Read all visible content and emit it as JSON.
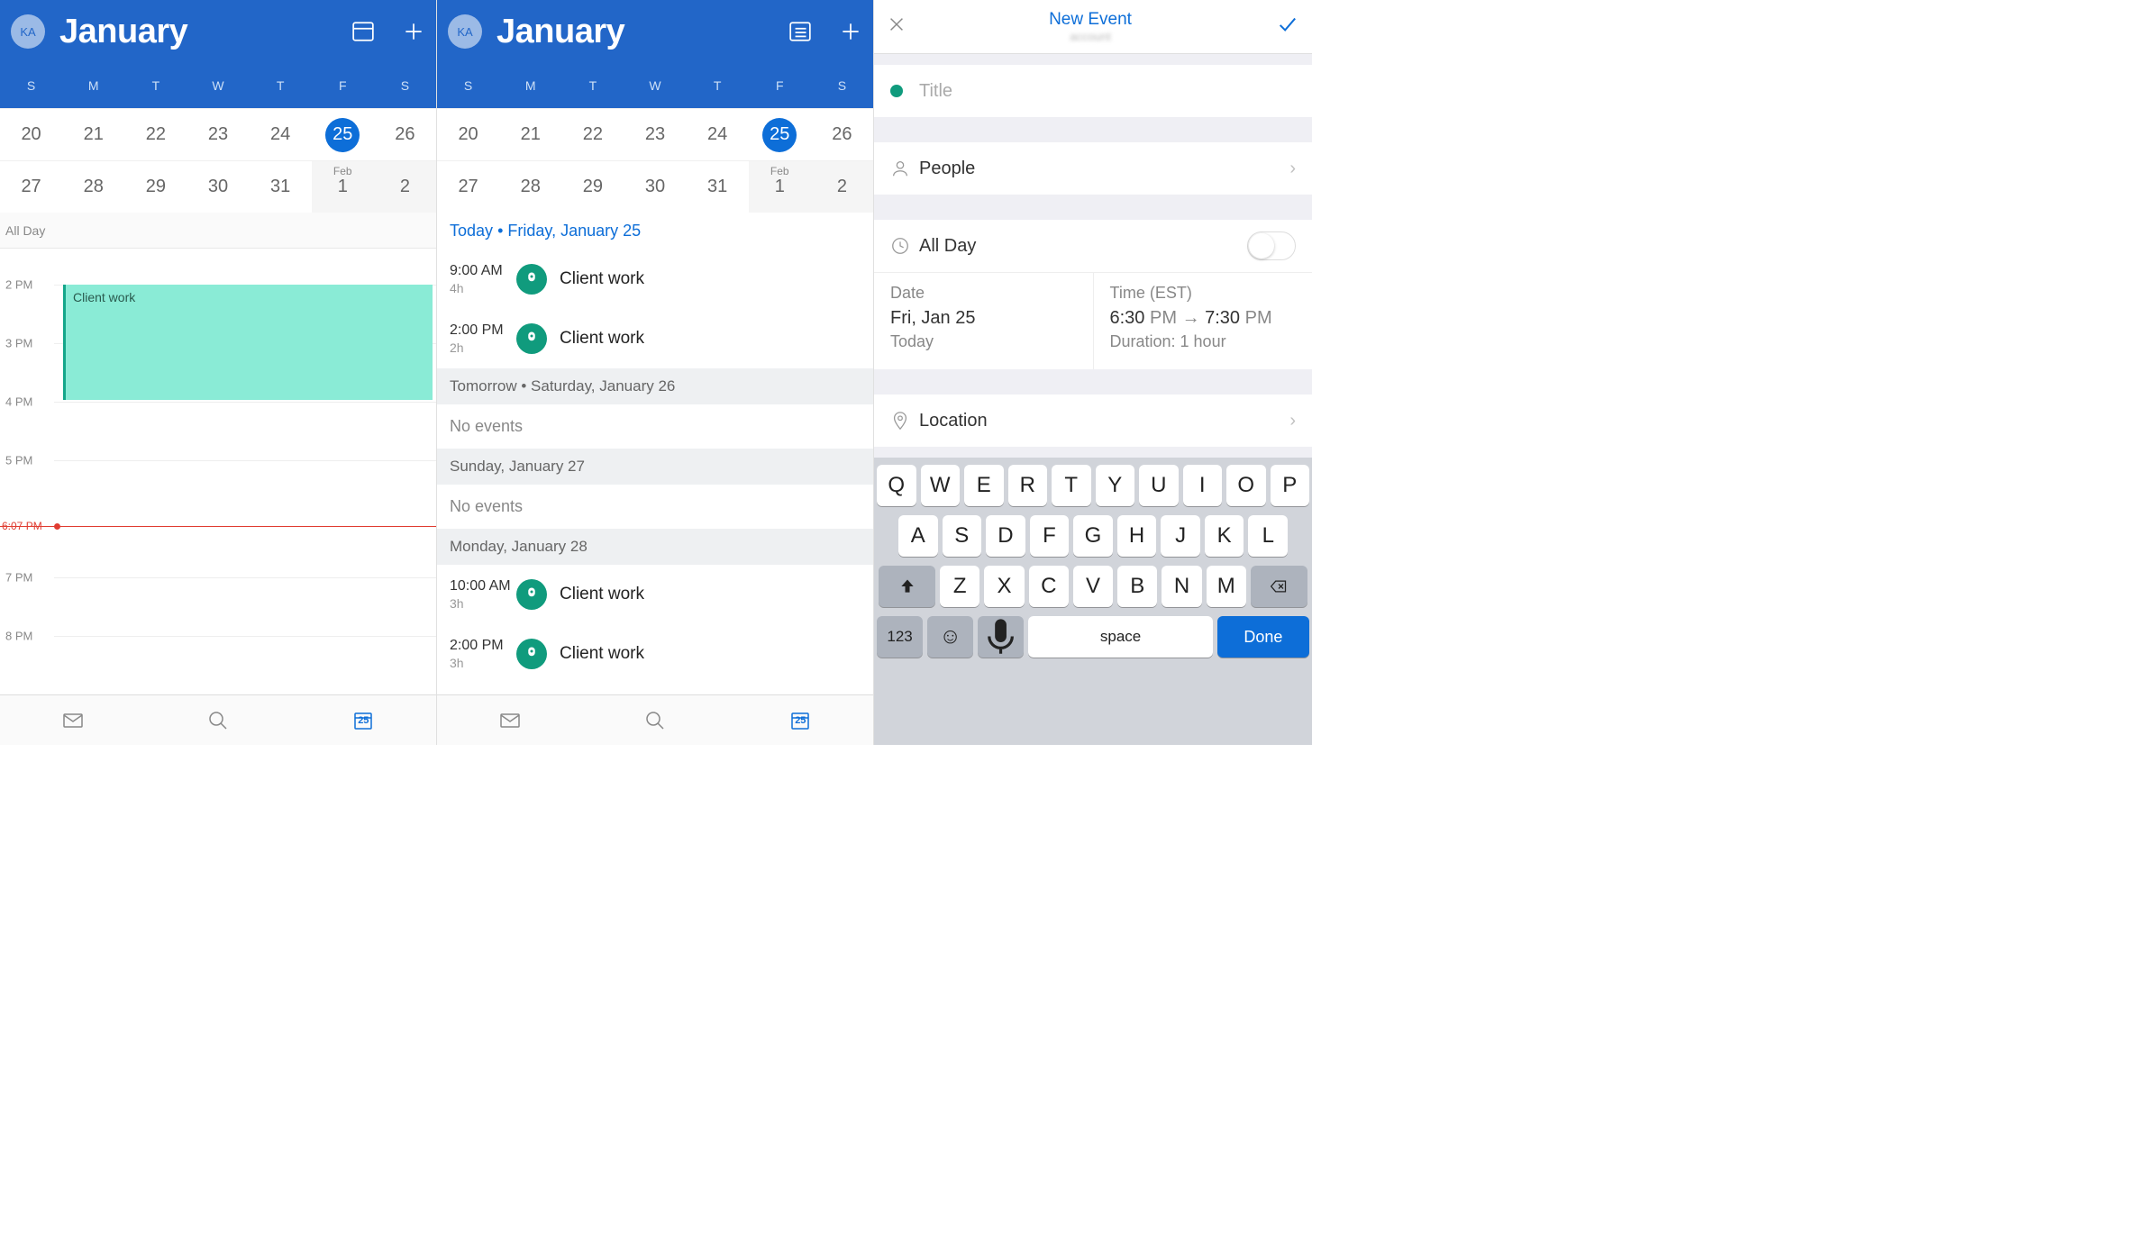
{
  "avatar": "KA",
  "month": "January",
  "weekdays": [
    "S",
    "M",
    "T",
    "W",
    "T",
    "F",
    "S"
  ],
  "row1": [
    "20",
    "21",
    "22",
    "23",
    "24",
    "25",
    "26"
  ],
  "row2": [
    "27",
    "28",
    "29",
    "30",
    "31",
    "1",
    "2"
  ],
  "row2_month": "Feb",
  "allday": "All Day",
  "hours": [
    "2 PM",
    "3 PM",
    "4 PM",
    "5 PM",
    "7 PM",
    "8 PM"
  ],
  "now_time": "6:07 PM",
  "day_event": "Client work",
  "tab_date": "25",
  "agenda": {
    "today_hdr_prefix": "Today",
    "today_hdr_date": "Friday, January 25",
    "events_today": [
      {
        "time": "9:00 AM",
        "dur": "4h",
        "title": "Client work"
      },
      {
        "time": "2:00 PM",
        "dur": "2h",
        "title": "Client work"
      }
    ],
    "tomorrow_hdr": "Tomorrow • Saturday, January 26",
    "no_events": "No events",
    "sunday_hdr": "Sunday, January 27",
    "monday_hdr": "Monday, January 28",
    "events_monday": [
      {
        "time": "10:00 AM",
        "dur": "3h",
        "title": "Client work"
      },
      {
        "time": "2:00 PM",
        "dur": "3h",
        "title": "Client work"
      }
    ]
  },
  "new_event": {
    "title": "New Event",
    "title_placeholder": "Title",
    "people": "People",
    "allday": "All Day",
    "date_label": "Date",
    "date_value": "Fri, Jan 25",
    "date_sub": "Today",
    "time_label": "Time (EST)",
    "time_start": "6:30",
    "time_end": "7:30",
    "pm": "PM",
    "duration": "Duration: 1 hour",
    "location": "Location"
  },
  "kbd": {
    "r1": [
      "Q",
      "W",
      "E",
      "R",
      "T",
      "Y",
      "U",
      "I",
      "O",
      "P"
    ],
    "r2": [
      "A",
      "S",
      "D",
      "F",
      "G",
      "H",
      "J",
      "K",
      "L"
    ],
    "r3": [
      "Z",
      "X",
      "C",
      "V",
      "B",
      "N",
      "M"
    ],
    "num": "123",
    "space": "space",
    "done": "Done"
  }
}
